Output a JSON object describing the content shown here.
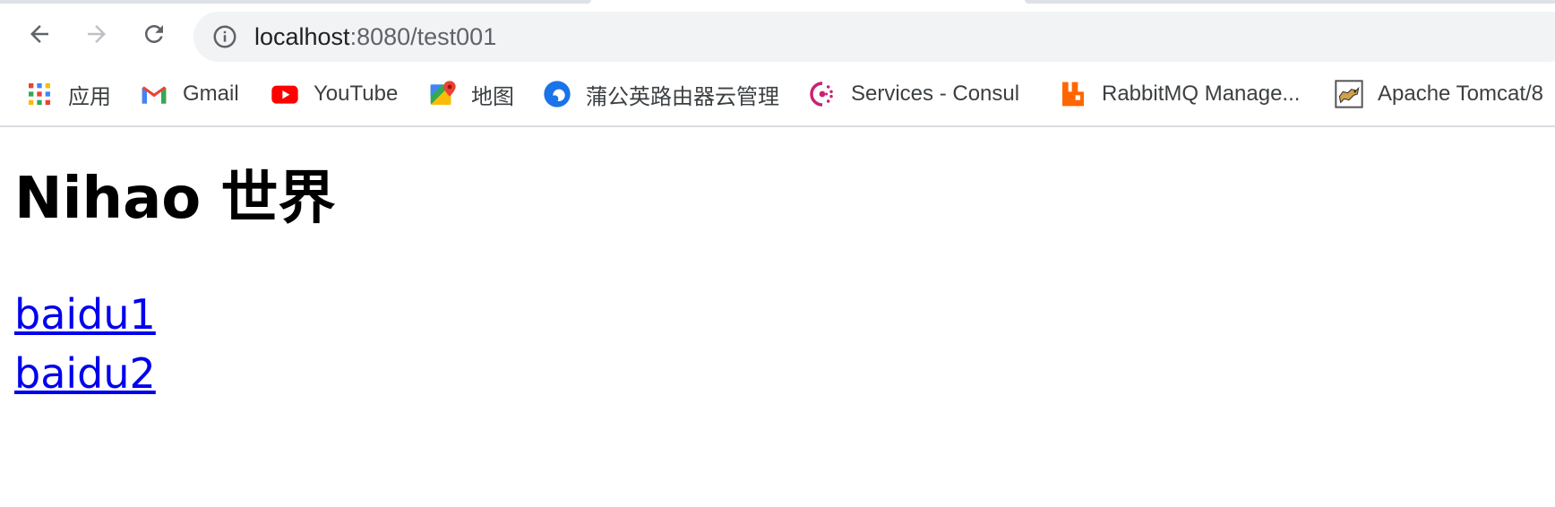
{
  "browser": {
    "address_bar": {
      "url_host": "localhost",
      "url_rest": ":8080/test001"
    },
    "bookmarks": [
      {
        "label": "应用",
        "icon": "apps-grid-icon"
      },
      {
        "label": "Gmail",
        "icon": "gmail-icon"
      },
      {
        "label": "YouTube",
        "icon": "youtube-icon"
      },
      {
        "label": "地图",
        "icon": "maps-icon"
      },
      {
        "label": "蒲公英路由器云管理",
        "icon": "pgy-icon"
      },
      {
        "label": "Services - Consul",
        "icon": "consul-icon"
      },
      {
        "label": "RabbitMQ Manage...",
        "icon": "rabbitmq-icon"
      },
      {
        "label": "Apache Tomcat/8",
        "icon": "tomcat-icon"
      }
    ],
    "colors": {
      "link": "#0000ee",
      "omnibox_bg": "#f1f3f4",
      "youtube_red": "#ff0000",
      "rabbitmq_orange": "#ff6600",
      "consul_pink": "#ca2171"
    }
  },
  "page": {
    "title": "Nihao 世界",
    "links": [
      "baidu1",
      "baidu2"
    ]
  }
}
